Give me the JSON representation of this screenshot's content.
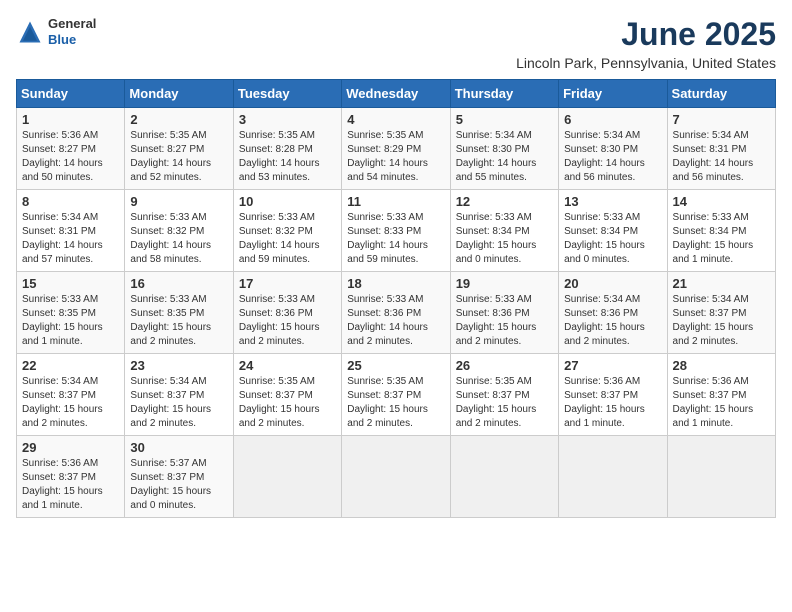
{
  "logo": {
    "general": "General",
    "blue": "Blue"
  },
  "title": {
    "month_year": "June 2025",
    "location": "Lincoln Park, Pennsylvania, United States"
  },
  "calendar": {
    "headers": [
      "Sunday",
      "Monday",
      "Tuesday",
      "Wednesday",
      "Thursday",
      "Friday",
      "Saturday"
    ],
    "rows": [
      [
        {
          "day": "1",
          "info": "Sunrise: 5:36 AM\nSunset: 8:27 PM\nDaylight: 14 hours\nand 50 minutes."
        },
        {
          "day": "2",
          "info": "Sunrise: 5:35 AM\nSunset: 8:27 PM\nDaylight: 14 hours\nand 52 minutes."
        },
        {
          "day": "3",
          "info": "Sunrise: 5:35 AM\nSunset: 8:28 PM\nDaylight: 14 hours\nand 53 minutes."
        },
        {
          "day": "4",
          "info": "Sunrise: 5:35 AM\nSunset: 8:29 PM\nDaylight: 14 hours\nand 54 minutes."
        },
        {
          "day": "5",
          "info": "Sunrise: 5:34 AM\nSunset: 8:30 PM\nDaylight: 14 hours\nand 55 minutes."
        },
        {
          "day": "6",
          "info": "Sunrise: 5:34 AM\nSunset: 8:30 PM\nDaylight: 14 hours\nand 56 minutes."
        },
        {
          "day": "7",
          "info": "Sunrise: 5:34 AM\nSunset: 8:31 PM\nDaylight: 14 hours\nand 56 minutes."
        }
      ],
      [
        {
          "day": "8",
          "info": "Sunrise: 5:34 AM\nSunset: 8:31 PM\nDaylight: 14 hours\nand 57 minutes."
        },
        {
          "day": "9",
          "info": "Sunrise: 5:33 AM\nSunset: 8:32 PM\nDaylight: 14 hours\nand 58 minutes."
        },
        {
          "day": "10",
          "info": "Sunrise: 5:33 AM\nSunset: 8:32 PM\nDaylight: 14 hours\nand 59 minutes."
        },
        {
          "day": "11",
          "info": "Sunrise: 5:33 AM\nSunset: 8:33 PM\nDaylight: 14 hours\nand 59 minutes."
        },
        {
          "day": "12",
          "info": "Sunrise: 5:33 AM\nSunset: 8:34 PM\nDaylight: 15 hours\nand 0 minutes."
        },
        {
          "day": "13",
          "info": "Sunrise: 5:33 AM\nSunset: 8:34 PM\nDaylight: 15 hours\nand 0 minutes."
        },
        {
          "day": "14",
          "info": "Sunrise: 5:33 AM\nSunset: 8:34 PM\nDaylight: 15 hours\nand 1 minute."
        }
      ],
      [
        {
          "day": "15",
          "info": "Sunrise: 5:33 AM\nSunset: 8:35 PM\nDaylight: 15 hours\nand 1 minute."
        },
        {
          "day": "16",
          "info": "Sunrise: 5:33 AM\nSunset: 8:35 PM\nDaylight: 15 hours\nand 2 minutes."
        },
        {
          "day": "17",
          "info": "Sunrise: 5:33 AM\nSunset: 8:36 PM\nDaylight: 15 hours\nand 2 minutes."
        },
        {
          "day": "18",
          "info": "Sunrise: 5:33 AM\nSunset: 8:36 PM\nDaylight: 14 hours\nand 2 minutes."
        },
        {
          "day": "19",
          "info": "Sunrise: 5:33 AM\nSunset: 8:36 PM\nDaylight: 15 hours\nand 2 minutes."
        },
        {
          "day": "20",
          "info": "Sunrise: 5:34 AM\nSunset: 8:36 PM\nDaylight: 15 hours\nand 2 minutes."
        },
        {
          "day": "21",
          "info": "Sunrise: 5:34 AM\nSunset: 8:37 PM\nDaylight: 15 hours\nand 2 minutes."
        }
      ],
      [
        {
          "day": "22",
          "info": "Sunrise: 5:34 AM\nSunset: 8:37 PM\nDaylight: 15 hours\nand 2 minutes."
        },
        {
          "day": "23",
          "info": "Sunrise: 5:34 AM\nSunset: 8:37 PM\nDaylight: 15 hours\nand 2 minutes."
        },
        {
          "day": "24",
          "info": "Sunrise: 5:35 AM\nSunset: 8:37 PM\nDaylight: 15 hours\nand 2 minutes."
        },
        {
          "day": "25",
          "info": "Sunrise: 5:35 AM\nSunset: 8:37 PM\nDaylight: 15 hours\nand 2 minutes."
        },
        {
          "day": "26",
          "info": "Sunrise: 5:35 AM\nSunset: 8:37 PM\nDaylight: 15 hours\nand 2 minutes."
        },
        {
          "day": "27",
          "info": "Sunrise: 5:36 AM\nSunset: 8:37 PM\nDaylight: 15 hours\nand 1 minute."
        },
        {
          "day": "28",
          "info": "Sunrise: 5:36 AM\nSunset: 8:37 PM\nDaylight: 15 hours\nand 1 minute."
        }
      ],
      [
        {
          "day": "29",
          "info": "Sunrise: 5:36 AM\nSunset: 8:37 PM\nDaylight: 15 hours\nand 1 minute."
        },
        {
          "day": "30",
          "info": "Sunrise: 5:37 AM\nSunset: 8:37 PM\nDaylight: 15 hours\nand 0 minutes."
        },
        {
          "day": "",
          "info": ""
        },
        {
          "day": "",
          "info": ""
        },
        {
          "day": "",
          "info": ""
        },
        {
          "day": "",
          "info": ""
        },
        {
          "day": "",
          "info": ""
        }
      ]
    ]
  }
}
